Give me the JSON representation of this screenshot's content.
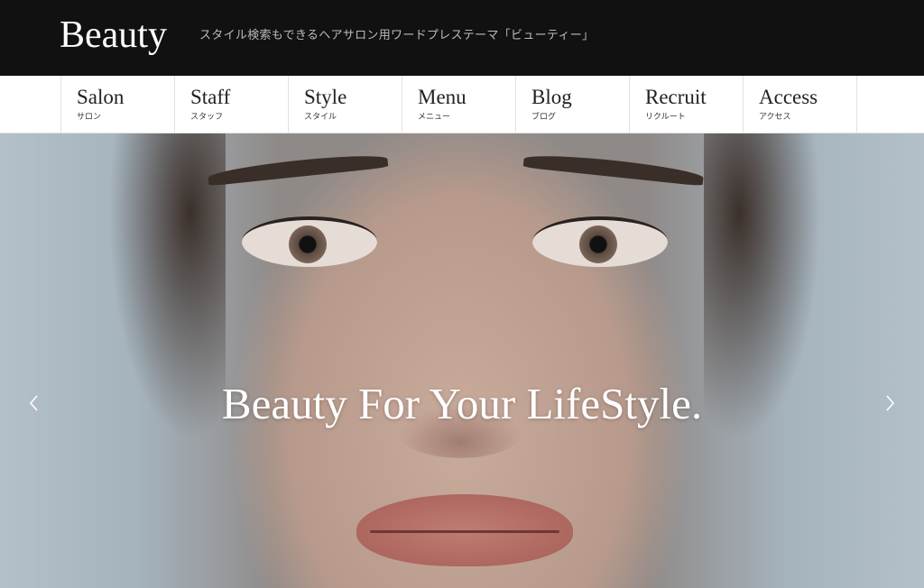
{
  "header": {
    "logo": "Beauty",
    "tagline": "スタイル検索もできるヘアサロン用ワードプレステーマ「ビューティー」"
  },
  "nav": {
    "items": [
      {
        "label": "Salon",
        "sub": "サロン"
      },
      {
        "label": "Staff",
        "sub": "スタッフ"
      },
      {
        "label": "Style",
        "sub": "スタイル"
      },
      {
        "label": "Menu",
        "sub": "メニュー"
      },
      {
        "label": "Blog",
        "sub": "ブログ"
      },
      {
        "label": "Recruit",
        "sub": "リクルート"
      },
      {
        "label": "Access",
        "sub": "アクセス"
      }
    ]
  },
  "hero": {
    "title": "Beauty For Your LifeStyle.",
    "prev_icon": "chevron-left-icon",
    "next_icon": "chevron-right-icon"
  },
  "colors": {
    "header_bg": "#111111",
    "nav_bg": "#ffffff",
    "border": "#e2e2e2"
  }
}
